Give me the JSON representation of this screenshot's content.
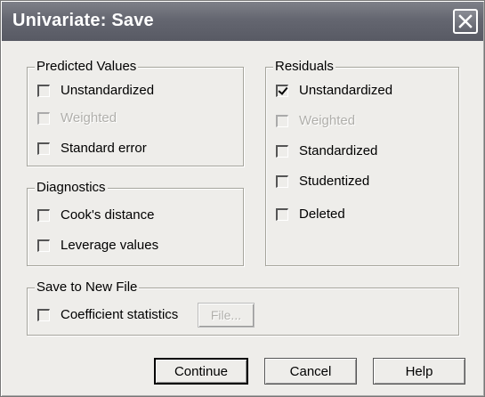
{
  "dialog": {
    "title": "Univariate: Save"
  },
  "predicted_values": {
    "label": "Predicted Values",
    "items": [
      {
        "label": "Unstandardized",
        "checked": false,
        "enabled": true
      },
      {
        "label": "Weighted",
        "checked": false,
        "enabled": false
      },
      {
        "label": "Standard error",
        "checked": false,
        "enabled": true
      }
    ]
  },
  "diagnostics": {
    "label": "Diagnostics",
    "items": [
      {
        "label": "Cook's distance",
        "checked": false,
        "enabled": true
      },
      {
        "label": "Leverage values",
        "checked": false,
        "enabled": true
      }
    ]
  },
  "residuals": {
    "label": "Residuals",
    "items": [
      {
        "label": "Unstandardized",
        "checked": true,
        "enabled": true
      },
      {
        "label": "Weighted",
        "checked": false,
        "enabled": false
      },
      {
        "label": "Standardized",
        "checked": false,
        "enabled": true
      },
      {
        "label": "Studentized",
        "checked": false,
        "enabled": true
      },
      {
        "label": "Deleted",
        "checked": false,
        "enabled": true
      }
    ]
  },
  "save_to_new_file": {
    "label": "Save to New File",
    "coefficient_label": "Coefficient statistics",
    "file_button": "File..."
  },
  "buttons": {
    "continue": "Continue",
    "cancel": "Cancel",
    "help": "Help"
  },
  "icons": {
    "close": "close-icon"
  }
}
